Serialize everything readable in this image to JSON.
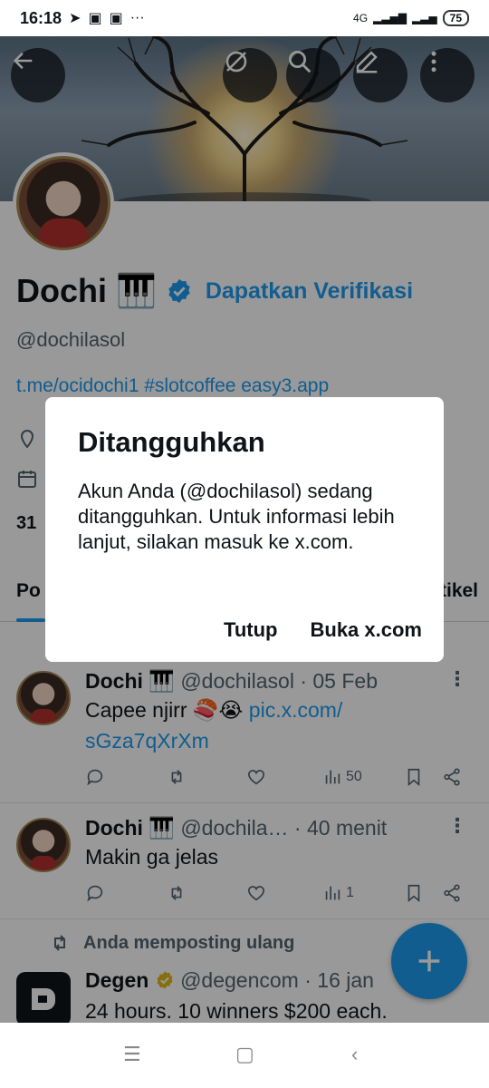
{
  "status_bar": {
    "time": "16:18",
    "dots": "···",
    "network": "4G",
    "battery": "75"
  },
  "profile": {
    "name": "Dochi 🎹",
    "get_verified": "Dapatkan Verifikasi",
    "handle": "@dochilasol",
    "links": "t.me/ocidochi1  #slotcoffee  easy3.app",
    "count_visible": "31",
    "tab_posts_partial": "Po",
    "tab_articles_partial": "tikel"
  },
  "dialog": {
    "title": "Ditangguhkan",
    "message": "Akun Anda (@dochilasol) sedang ditangguhkan. Untuk informasi lebih lanjut, silakan masuk ke x.com.",
    "close_label": "Tutup",
    "open_label": "Buka x.com"
  },
  "posts": [
    {
      "name": "Dochi 🎹",
      "handle": "@dochilasol · 05 Feb",
      "text": "Capee njirr 🍣😭 ",
      "link": "pic.x.com/",
      "link2": "sGza7qXrXm",
      "views": "50"
    },
    {
      "name": "Dochi 🎹",
      "handle": "@dochila…  · 40 menit",
      "text": "Makin ga jelas",
      "views": "1"
    }
  ],
  "repost": {
    "label": "Anda memposting ulang",
    "name": "Degen",
    "handle": "@degencom · 16 jan",
    "text": "24 hours. 10 winners $200 each."
  },
  "colors": {
    "accent": "#1d9bf0",
    "text": "#0f1419",
    "muted": "#536471"
  }
}
